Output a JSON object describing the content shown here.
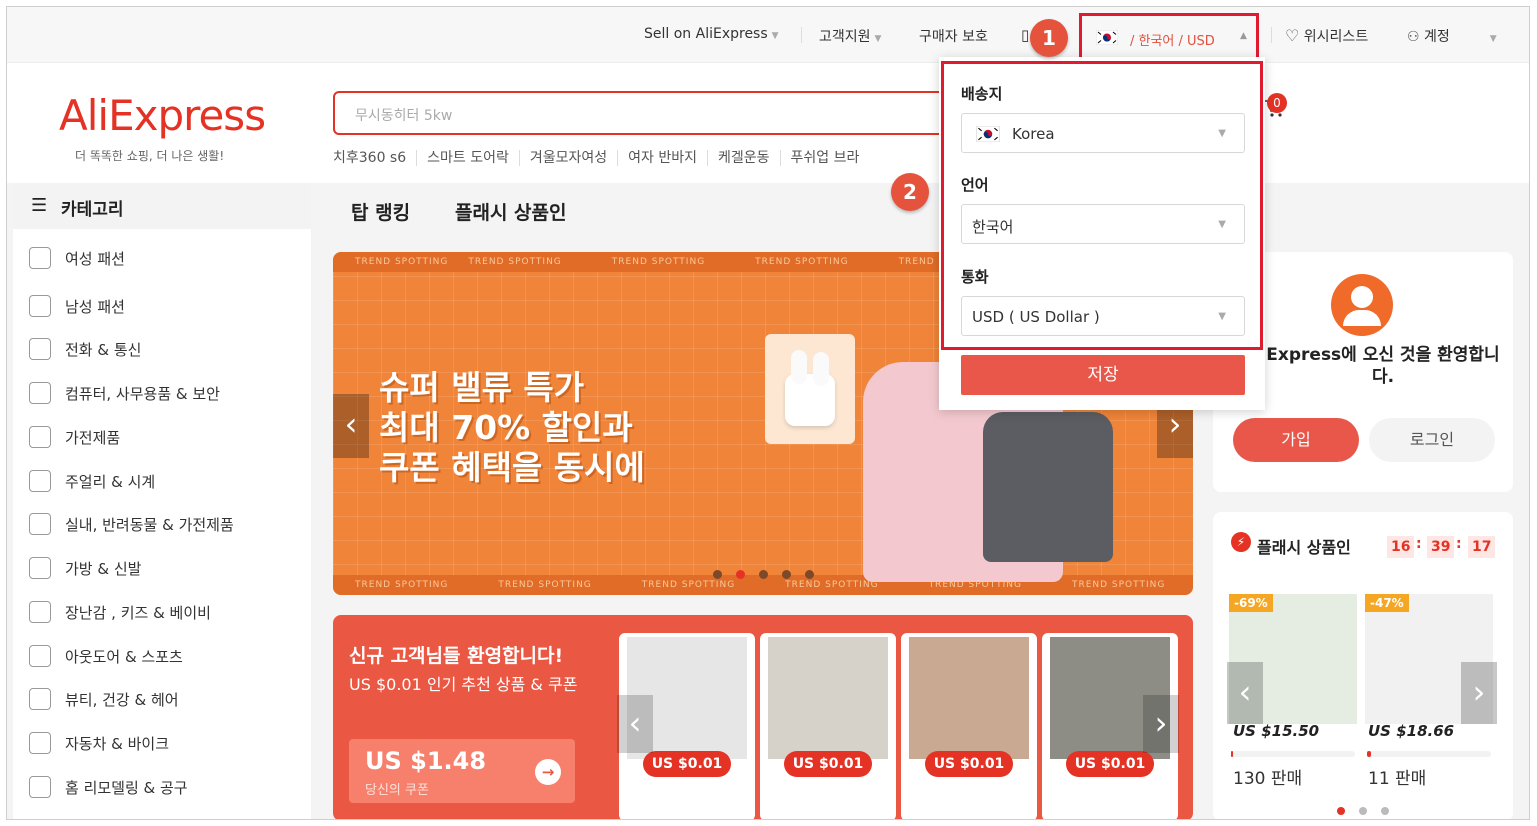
{
  "topbar": {
    "sell": "Sell on AliExpress",
    "support": "고객지원",
    "buyer_protection": "구매자 보호",
    "locale": "/ 한국어 /  USD",
    "wishlist": "위시리스트",
    "account": "계정"
  },
  "annotations": {
    "step1": "1",
    "step2": "2"
  },
  "header": {
    "logo": "AliExpress",
    "slogan": "더 똑똑한 쇼핑, 더 나은 생활!",
    "search_placeholder": "무시동히터 5kw",
    "hot_keywords": [
      "치후360 s6",
      "스마트 도어락",
      "겨울모자여성",
      "여자 반바지",
      "케겔운동",
      "푸쉬업 브라"
    ],
    "cart_count": "0"
  },
  "sidebar": {
    "title": "카테고리",
    "items": [
      {
        "label": "여성 패션",
        "icon": "dress-icon"
      },
      {
        "label": "남성 패션",
        "icon": "shirt-icon"
      },
      {
        "label": "전화 & 통신",
        "icon": "phone-icon"
      },
      {
        "label": "컴퓨터, 사무용품 & 보안",
        "icon": "laptop-icon"
      },
      {
        "label": "가전제품",
        "icon": "camera-icon"
      },
      {
        "label": "주얼리 & 시계",
        "icon": "ring-icon"
      },
      {
        "label": "실내, 반려동물 & 가전제품",
        "icon": "sofa-icon"
      },
      {
        "label": "가방 & 신발",
        "icon": "bag-icon"
      },
      {
        "label": "장난감 , 키즈 & 베이비",
        "icon": "bottle-icon"
      },
      {
        "label": "아웃도어 & 스포츠",
        "icon": "ball-icon"
      },
      {
        "label": "뷰티, 건강 & 헤어",
        "icon": "bulb-icon"
      },
      {
        "label": "자동차 & 바이크",
        "icon": "wheel-icon"
      },
      {
        "label": "홈 리모델링 & 공구",
        "icon": "tool-icon"
      }
    ]
  },
  "tabs": [
    "탑 랭킹",
    "플래시 상품인"
  ],
  "banner": {
    "line1": "슈퍼 밸류 특가",
    "line2": "최대 70% 할인과",
    "line3": "쿠폰 혜택을 동시에",
    "stripe_text": "TREND SPOTTING",
    "slides": 5,
    "active_slide": 2
  },
  "promo": {
    "title": "신규 고객님들 환영합니다!",
    "subtitle": "US $0.01 인기 추천 상품 & 쿠폰",
    "coupon_amount": "US $1.48",
    "coupon_label": "당신의 쿠폰",
    "products": [
      {
        "price": "US $0.01"
      },
      {
        "price": "US $0.01"
      },
      {
        "price": "US $0.01"
      },
      {
        "price": "US $0.01"
      }
    ]
  },
  "dropdown": {
    "ship_to_label": "배송지",
    "ship_to_value": "Korea",
    "language_label": "언어",
    "language_value": "한국어",
    "currency_label": "통화",
    "currency_value": "USD ( US Dollar )",
    "save": "저장"
  },
  "account_card": {
    "welcome": "Express에 오신 것을 환영합니다.",
    "join": "가입",
    "login": "로그인"
  },
  "flash": {
    "title": "플래시 상품인",
    "timer": [
      "16",
      "39",
      "17"
    ],
    "items": [
      {
        "discount": "-69%",
        "price": "US $15.50",
        "sold": "130 판매",
        "sold_fraction": 0.0
      },
      {
        "discount": "-47%",
        "price": "US $18.66",
        "sold": "11 판매",
        "sold_fraction": 0.03
      }
    ]
  },
  "colors": {
    "brand": "#e43225",
    "highlight_box": "#e01b2f",
    "banner": "#f08439"
  }
}
